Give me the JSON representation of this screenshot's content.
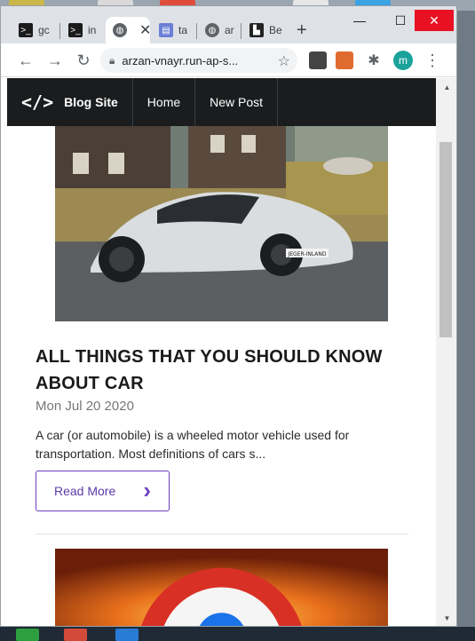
{
  "colors": {
    "accent": "#6f42c1",
    "navbar_bg": "#1a1c1e",
    "close_button": "#e81123",
    "avatar": "#1aa39a"
  },
  "browser": {
    "tabs": [
      {
        "label": "gc",
        "icon": "terminal-icon"
      },
      {
        "label": "in",
        "icon": "terminal-icon"
      },
      {
        "label": "",
        "icon": "globe-icon",
        "active": true
      },
      {
        "label": "ta",
        "icon": "extension-page-icon"
      },
      {
        "label": "ar",
        "icon": "globe-icon"
      },
      {
        "label": "Be",
        "icon": "site-logo-icon"
      }
    ],
    "new_tab_symbol": "+",
    "address": "arzan-vnayr.run-ap-s...",
    "avatar_letter": "m",
    "window_controls": {
      "minimize": "—",
      "maximize": "☐",
      "close": "✕"
    }
  },
  "navbar": {
    "brand_icon": "</>",
    "brand_name": "Blog Site",
    "items": [
      "Home",
      "New Post"
    ]
  },
  "post": {
    "title": "ALL THINGS THAT YOU SHOULD KNOW ABOUT CAR",
    "date": "Mon Jul 20 2020",
    "excerpt": "A car (or automobile) is a wheeled motor vehicle used for transportation. Most definitions of cars s...",
    "read_more_label": "Read More",
    "image_plate": "JEGER-INLAND"
  }
}
